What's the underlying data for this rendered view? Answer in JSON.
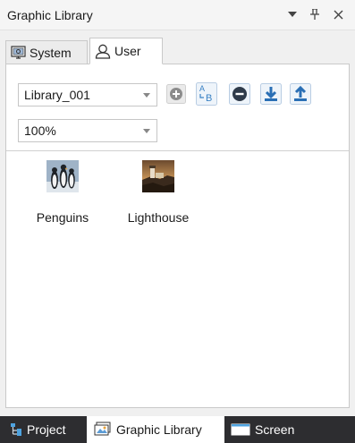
{
  "window": {
    "title": "Graphic Library"
  },
  "title_buttons": {
    "dropdown_icon": "caret-down-icon",
    "pin_icon": "pin-icon",
    "close_icon": "close-icon"
  },
  "tabs": [
    {
      "label": "System",
      "icon": "monitor-icon",
      "active": false
    },
    {
      "label": "User",
      "icon": "user-icon",
      "active": true
    }
  ],
  "library_select": {
    "value": "Library_001"
  },
  "zoom_select": {
    "value": "100%"
  },
  "toolbar": {
    "buttons": [
      {
        "name": "add",
        "icon": "plus-circle-icon"
      },
      {
        "name": "rename",
        "icon": "rename-ab-icon"
      },
      {
        "name": "remove",
        "icon": "minus-circle-icon"
      },
      {
        "name": "import",
        "icon": "download-icon"
      },
      {
        "name": "export",
        "icon": "upload-icon"
      }
    ]
  },
  "gallery": {
    "items": [
      {
        "label": "Penguins",
        "icon": "penguins-thumbnail"
      },
      {
        "label": "Lighthouse",
        "icon": "lighthouse-thumbnail"
      }
    ]
  },
  "bottom_tabs": [
    {
      "label": "Project",
      "icon": "project-tree-icon",
      "active": false
    },
    {
      "label": "Graphic Library",
      "icon": "graphic-library-icon",
      "active": true
    },
    {
      "label": "Screen",
      "icon": "screen-icon",
      "active": false
    }
  ],
  "colors": {
    "panel_bg": "#f0f0f0",
    "bottom_bar_bg": "#2d2d30",
    "tool_icon_blue": "#3b82c4",
    "tool_icon_gray": "#6e6e6e"
  }
}
